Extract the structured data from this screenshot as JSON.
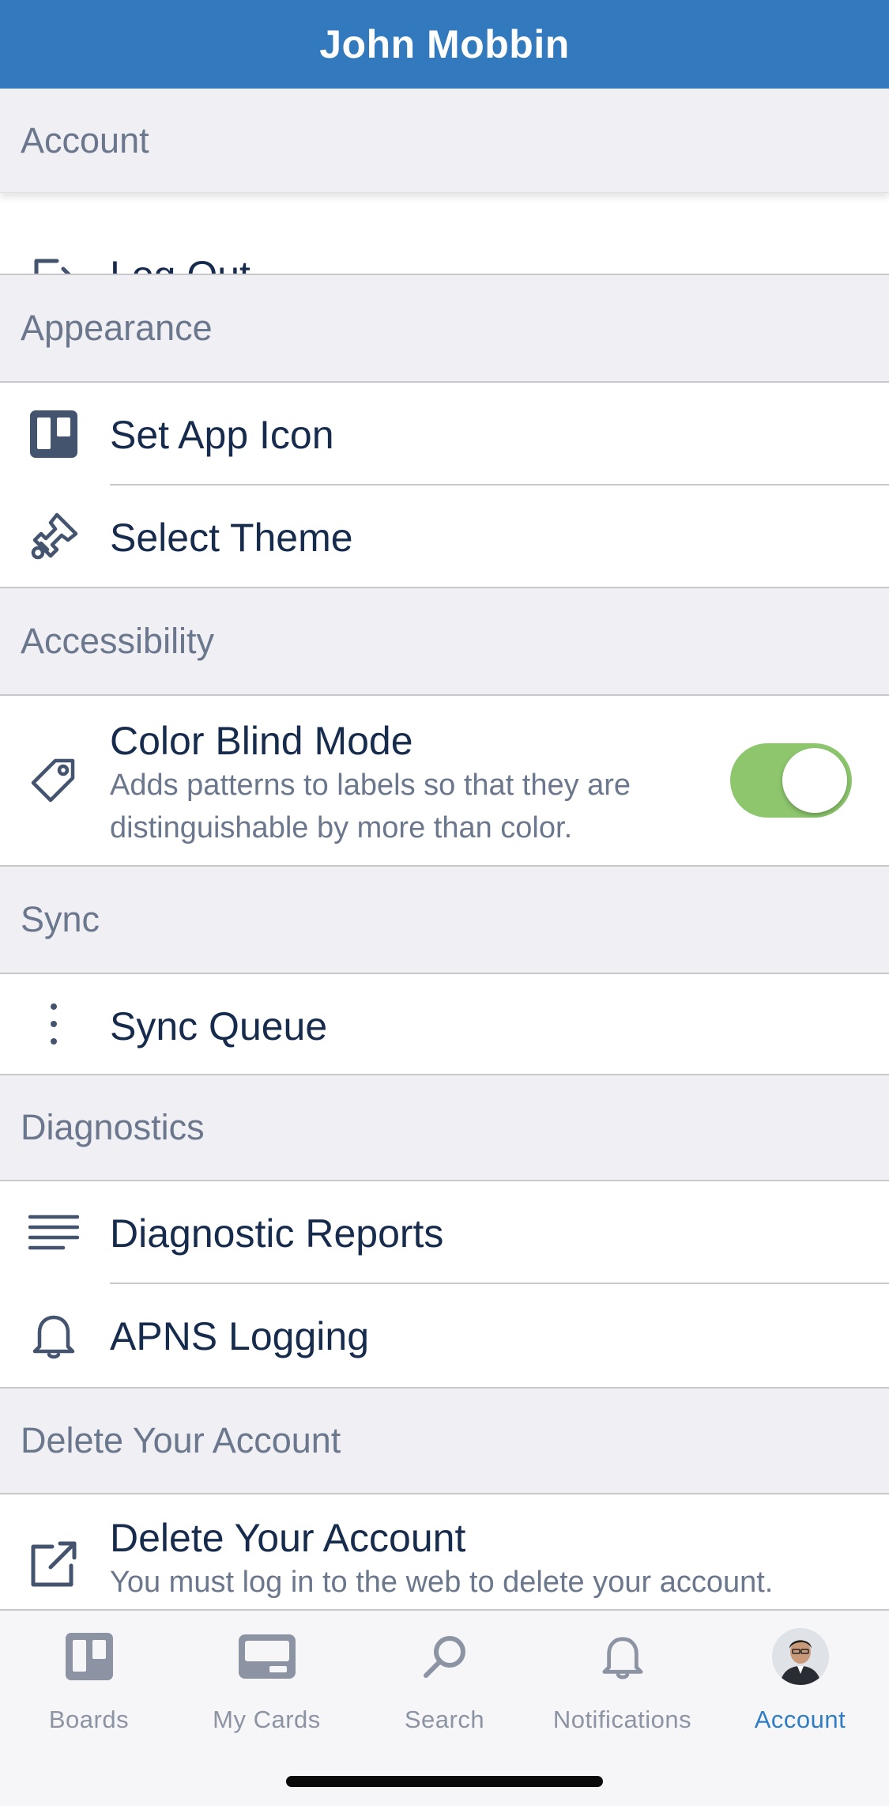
{
  "header": {
    "title": "John Mobbin"
  },
  "sections": {
    "account": {
      "title": "Account",
      "log_out": "Log Out"
    },
    "appearance": {
      "title": "Appearance",
      "set_app_icon": "Set App Icon",
      "select_theme": "Select Theme"
    },
    "accessibility": {
      "title": "Accessibility",
      "color_blind_mode": {
        "label": "Color Blind Mode",
        "description_line1": "Adds patterns to labels so that they are",
        "description_line2": "distinguishable by more than color.",
        "enabled": true
      }
    },
    "sync": {
      "title": "Sync",
      "sync_queue": "Sync Queue"
    },
    "diagnostics": {
      "title": "Diagnostics",
      "diagnostic_reports": "Diagnostic Reports",
      "apns_logging": "APNS Logging"
    },
    "delete": {
      "title": "Delete Your Account",
      "label": "Delete Your Account",
      "description": "You must log in to the web to delete your account."
    }
  },
  "tabbar": {
    "items": [
      {
        "label": "Boards",
        "icon": "boards-icon"
      },
      {
        "label": "My Cards",
        "icon": "card-icon"
      },
      {
        "label": "Search",
        "icon": "search-icon"
      },
      {
        "label": "Notifications",
        "icon": "bell-icon"
      },
      {
        "label": "Account",
        "icon": "avatar"
      }
    ],
    "active": "Account"
  },
  "colors": {
    "header_bg": "#3379bd",
    "toggle_on": "#8dc66d",
    "tab_active": "#2f7dc3",
    "tab_inactive": "#8c93a3"
  }
}
